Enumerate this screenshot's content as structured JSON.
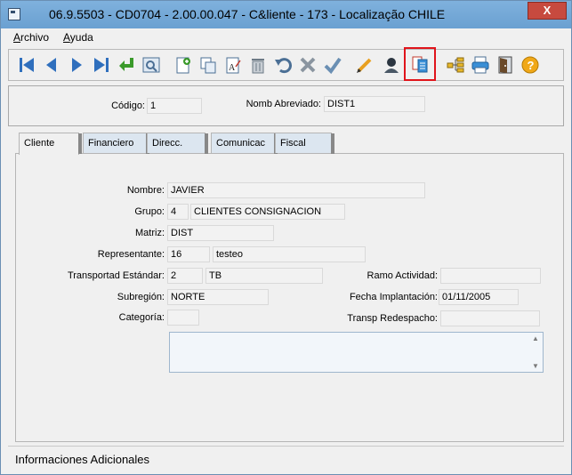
{
  "window": {
    "title": "06.9.5503 - CD0704 - 2.00.00.047 - C&liente - 173 - Localização CHILE",
    "close_glyph": "X"
  },
  "menu": {
    "archivo": "Archivo",
    "ayuda": "Ayuda"
  },
  "toolbar": {
    "buttons": [
      {
        "name": "first-record-icon"
      },
      {
        "name": "previous-record-icon"
      },
      {
        "name": "next-record-icon"
      },
      {
        "name": "last-record-icon"
      },
      {
        "name": "goto-record-icon"
      },
      {
        "name": "search-record-icon"
      },
      {
        "name": "new-record-icon"
      },
      {
        "name": "copy-record-icon"
      },
      {
        "name": "edit-record-icon"
      },
      {
        "name": "delete-record-icon"
      },
      {
        "name": "undo-icon"
      },
      {
        "name": "cancel-icon"
      },
      {
        "name": "save-check-icon"
      },
      {
        "name": "pencil-icon"
      },
      {
        "name": "user-icon"
      },
      {
        "name": "documents-icon"
      },
      {
        "name": "hierarchy-icon"
      },
      {
        "name": "print-icon"
      },
      {
        "name": "exit-door-icon"
      },
      {
        "name": "help-icon"
      }
    ]
  },
  "header": {
    "codigo_label": "Código:",
    "codigo_value": "1",
    "nomb_label": "Nomb Abreviado:",
    "nomb_value": "DIST1"
  },
  "tabs": [
    "Cliente",
    "Financiero",
    "Direcc.",
    "Comunicac",
    "Fiscal"
  ],
  "form": {
    "nombre_label": "Nombre:",
    "nombre_value": "JAVIER",
    "grupo_label": "Grupo:",
    "grupo_code": "4",
    "grupo_desc": "CLIENTES CONSIGNACION",
    "matriz_label": "Matriz:",
    "matriz_value": "DIST",
    "representante_label": "Representante:",
    "representante_code": "16",
    "representante_desc": "testeo",
    "transportad_label": "Transportad Estándar:",
    "transportad_code": "2",
    "transportad_desc": "TB",
    "ramo_label": "Ramo Actividad:",
    "ramo_value": "",
    "subregion_label": "Subregión:",
    "subregion_value": "NORTE",
    "fecha_label": "Fecha Implantación:",
    "fecha_value": "01/11/2005",
    "categoria_label": "Categoría:",
    "categoria_value": "",
    "transp_label": "Transp Redespacho:",
    "transp_value": ""
  },
  "memo": {
    "value": ""
  },
  "status": {
    "text": "Informaciones Adicionales"
  }
}
